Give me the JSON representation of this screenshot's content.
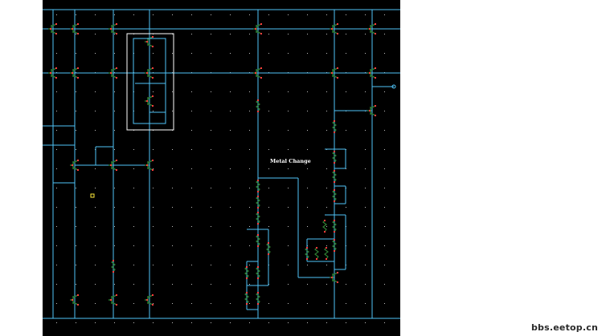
{
  "schematic": {
    "background": "#000000",
    "wire_color": "#4fc3f7",
    "device_color": "#2e7d32",
    "pin_color": "#ff3b3b",
    "box_color": "#ffffff",
    "grid_dot_color": "#bdbdbd",
    "annotation": "Metal Change"
  },
  "watermark": "bbs.eetop.cn"
}
